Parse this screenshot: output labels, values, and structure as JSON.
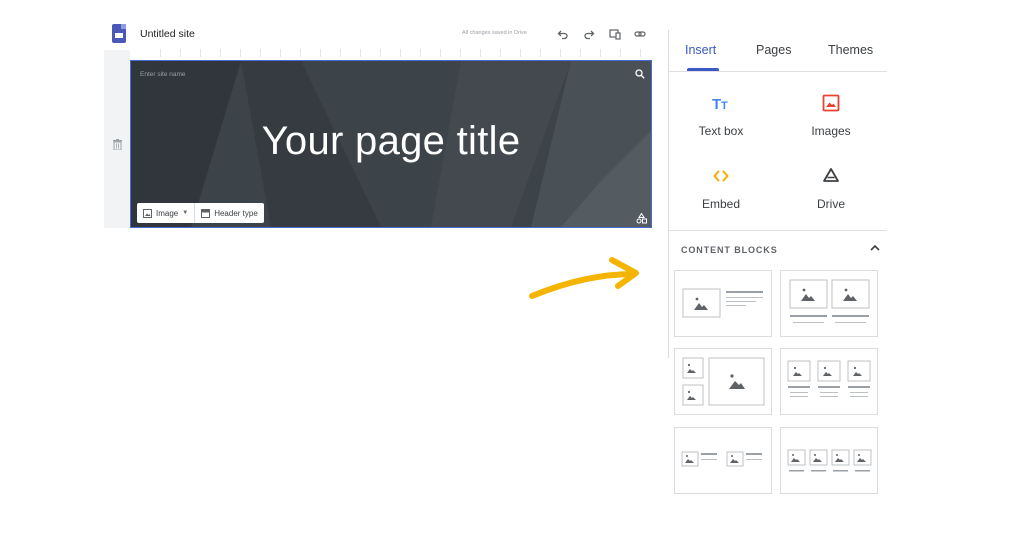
{
  "top_bar": {
    "site_name": "Untitled site",
    "save_status": "All changes saved in Drive"
  },
  "header": {
    "site_name_placeholder": "Enter site name",
    "page_title": "Your page title",
    "image_button": "Image",
    "header_type_button": "Header type"
  },
  "panel": {
    "tabs": [
      "Insert",
      "Pages",
      "Themes"
    ],
    "active_tab": "Insert",
    "insert_items": [
      "Text box",
      "Images",
      "Embed",
      "Drive"
    ],
    "content_blocks_title": "CONTENT BLOCKS"
  },
  "colors": {
    "accent": "#3b58c6",
    "header_bg": "#3c4349",
    "text_box_icon": "#4285f4",
    "images_icon": "#ea4335",
    "embed_icon": "#f9ab00",
    "annotation_arrow": "#f5b400"
  }
}
